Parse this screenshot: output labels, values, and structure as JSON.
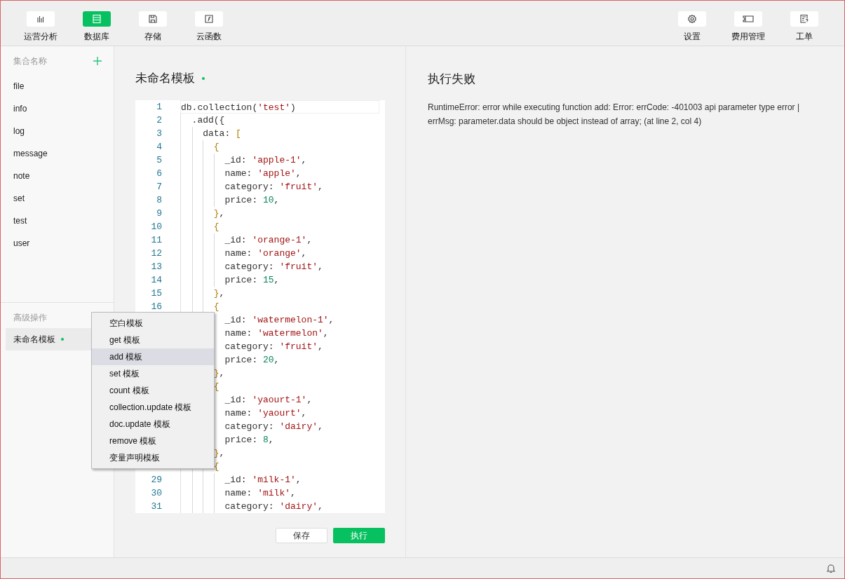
{
  "nav": {
    "left": [
      {
        "label": "运营分析",
        "selected": false
      },
      {
        "label": "数据库",
        "selected": true
      },
      {
        "label": "存储",
        "selected": false
      },
      {
        "label": "云函数",
        "selected": false
      }
    ],
    "right": [
      {
        "label": "设置"
      },
      {
        "label": "费用管理"
      },
      {
        "label": "工单"
      }
    ]
  },
  "sidebar": {
    "collections_title": "集合名称",
    "collections": [
      "file",
      "info",
      "log",
      "message",
      "note",
      "set",
      "test",
      "user"
    ],
    "advanced_title": "高级操作",
    "templates": [
      {
        "label": "未命名模板",
        "selected": true,
        "unsaved": true
      }
    ]
  },
  "editor": {
    "title": "未命名模板",
    "unsaved": true,
    "lines": [
      {
        "number": "1",
        "tokens": [
          {
            "kind": "plain",
            "text": "db.collection("
          },
          {
            "kind": "string",
            "text": "'test'"
          },
          {
            "kind": "plain",
            "text": ")"
          }
        ]
      },
      {
        "number": "2",
        "tokens": [
          {
            "kind": "plain",
            "text": "  .add({"
          }
        ]
      },
      {
        "number": "3",
        "tokens": [
          {
            "kind": "plain",
            "text": "    data: "
          },
          {
            "kind": "bracket",
            "text": "["
          }
        ]
      },
      {
        "number": "4",
        "tokens": [
          {
            "kind": "bracket",
            "text": "      {"
          }
        ]
      },
      {
        "number": "5",
        "tokens": [
          {
            "kind": "plain",
            "text": "        _id: "
          },
          {
            "kind": "string",
            "text": "'apple-1'"
          },
          {
            "kind": "plain",
            "text": ","
          }
        ]
      },
      {
        "number": "6",
        "tokens": [
          {
            "kind": "plain",
            "text": "        name: "
          },
          {
            "kind": "string",
            "text": "'apple'"
          },
          {
            "kind": "plain",
            "text": ","
          }
        ]
      },
      {
        "number": "7",
        "tokens": [
          {
            "kind": "plain",
            "text": "        category: "
          },
          {
            "kind": "string",
            "text": "'fruit'"
          },
          {
            "kind": "plain",
            "text": ","
          }
        ]
      },
      {
        "number": "8",
        "tokens": [
          {
            "kind": "plain",
            "text": "        price: "
          },
          {
            "kind": "number",
            "text": "10"
          },
          {
            "kind": "plain",
            "text": ","
          }
        ]
      },
      {
        "number": "9",
        "tokens": [
          {
            "kind": "bracket",
            "text": "      }"
          },
          {
            "kind": "plain",
            "text": ","
          }
        ]
      },
      {
        "number": "10",
        "tokens": [
          {
            "kind": "bracket",
            "text": "      {"
          }
        ]
      },
      {
        "number": "11",
        "tokens": [
          {
            "kind": "plain",
            "text": "        _id: "
          },
          {
            "kind": "string",
            "text": "'orange-1'"
          },
          {
            "kind": "plain",
            "text": ","
          }
        ]
      },
      {
        "number": "12",
        "tokens": [
          {
            "kind": "plain",
            "text": "        name: "
          },
          {
            "kind": "string",
            "text": "'orange'"
          },
          {
            "kind": "plain",
            "text": ","
          }
        ]
      },
      {
        "number": "13",
        "tokens": [
          {
            "kind": "plain",
            "text": "        category: "
          },
          {
            "kind": "string",
            "text": "'fruit'"
          },
          {
            "kind": "plain",
            "text": ","
          }
        ]
      },
      {
        "number": "14",
        "tokens": [
          {
            "kind": "plain",
            "text": "        price: "
          },
          {
            "kind": "number",
            "text": "15"
          },
          {
            "kind": "plain",
            "text": ","
          }
        ]
      },
      {
        "number": "15",
        "tokens": [
          {
            "kind": "bracket",
            "text": "      }"
          },
          {
            "kind": "plain",
            "text": ","
          }
        ]
      },
      {
        "number": "16",
        "tokens": [
          {
            "kind": "bracket",
            "text": "      {"
          }
        ]
      },
      {
        "tokens": [
          {
            "kind": "plain",
            "text": "        _id: "
          },
          {
            "kind": "string",
            "text": "'watermelon-1'"
          },
          {
            "kind": "plain",
            "text": ","
          }
        ]
      },
      {
        "tokens": [
          {
            "kind": "plain",
            "text": "        name: "
          },
          {
            "kind": "string",
            "text": "'watermelon'"
          },
          {
            "kind": "plain",
            "text": ","
          }
        ]
      },
      {
        "tokens": [
          {
            "kind": "plain",
            "text": "        category: "
          },
          {
            "kind": "string",
            "text": "'fruit'"
          },
          {
            "kind": "plain",
            "text": ","
          }
        ]
      },
      {
        "tokens": [
          {
            "kind": "plain",
            "text": "        price: "
          },
          {
            "kind": "number",
            "text": "20"
          },
          {
            "kind": "plain",
            "text": ","
          }
        ]
      },
      {
        "tokens": [
          {
            "kind": "bracket",
            "text": "      }"
          },
          {
            "kind": "plain",
            "text": ","
          }
        ]
      },
      {
        "tokens": [
          {
            "kind": "bracket",
            "text": "      {"
          }
        ]
      },
      {
        "tokens": [
          {
            "kind": "plain",
            "text": "        _id: "
          },
          {
            "kind": "string",
            "text": "'yaourt-1'"
          },
          {
            "kind": "plain",
            "text": ","
          }
        ]
      },
      {
        "tokens": [
          {
            "kind": "plain",
            "text": "        name: "
          },
          {
            "kind": "string",
            "text": "'yaourt'"
          },
          {
            "kind": "plain",
            "text": ","
          }
        ]
      },
      {
        "tokens": [
          {
            "kind": "plain",
            "text": "        category: "
          },
          {
            "kind": "string",
            "text": "'dairy'"
          },
          {
            "kind": "plain",
            "text": ","
          }
        ]
      },
      {
        "tokens": [
          {
            "kind": "plain",
            "text": "        price: "
          },
          {
            "kind": "number",
            "text": "8"
          },
          {
            "kind": "plain",
            "text": ","
          }
        ]
      },
      {
        "tokens": [
          {
            "kind": "bracket",
            "text": "      }"
          },
          {
            "kind": "plain",
            "text": ","
          }
        ]
      },
      {
        "tokens": [
          {
            "kind": "bracket",
            "text": "      {"
          }
        ]
      },
      {
        "number": "29",
        "tokens": [
          {
            "kind": "plain",
            "text": "        _id: "
          },
          {
            "kind": "string",
            "text": "'milk-1'"
          },
          {
            "kind": "plain",
            "text": ","
          }
        ]
      },
      {
        "number": "30",
        "tokens": [
          {
            "kind": "plain",
            "text": "        name: "
          },
          {
            "kind": "string",
            "text": "'milk'"
          },
          {
            "kind": "plain",
            "text": ","
          }
        ]
      },
      {
        "number": "31",
        "tokens": [
          {
            "kind": "plain",
            "text": "        category: "
          },
          {
            "kind": "string",
            "text": "'dairy'"
          },
          {
            "kind": "plain",
            "text": ","
          }
        ]
      }
    ]
  },
  "template_menu": {
    "items": [
      {
        "label": "空白模板",
        "selected": false
      },
      {
        "label": "get 模板",
        "selected": false
      },
      {
        "label": "add 模板",
        "selected": true
      },
      {
        "label": "set 模板",
        "selected": false
      },
      {
        "label": "count 模板",
        "selected": false
      },
      {
        "label": "collection.update 模板",
        "selected": false
      },
      {
        "label": "doc.update 模板",
        "selected": false
      },
      {
        "label": "remove 模板",
        "selected": false
      },
      {
        "label": "变量声明模板",
        "selected": false
      }
    ]
  },
  "buttons": [
    {
      "label": "保存",
      "kind": "secondary"
    },
    {
      "label": "执行",
      "kind": "primary"
    }
  ],
  "result": {
    "title": "执行失败",
    "message": "RuntimeError: error while executing function add: Error: errCode: -401003 api parameter type error | errMsg: parameter.data should be object instead of array; (at line 2, col 4)"
  }
}
